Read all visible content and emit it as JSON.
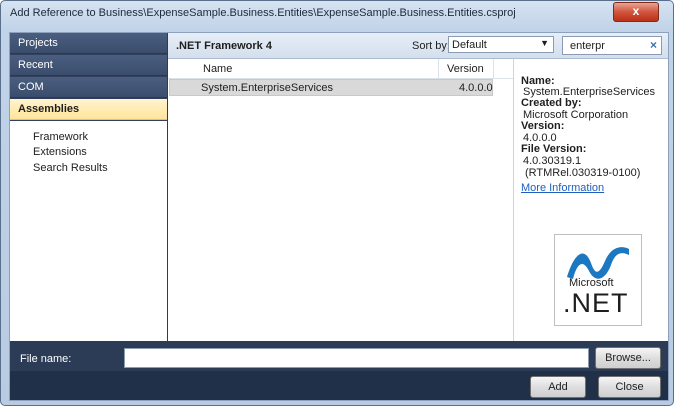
{
  "window": {
    "title": "Add Reference to Business\\ExpenseSample.Business.Entities\\ExpenseSample.Business.Entities.csproj",
    "close_label": "x"
  },
  "nav": {
    "tabs": [
      {
        "label": "Projects"
      },
      {
        "label": "Recent"
      },
      {
        "label": "COM"
      },
      {
        "label": "Assemblies"
      }
    ],
    "sub_items": [
      {
        "label": "Framework"
      },
      {
        "label": "Extensions"
      },
      {
        "label": "Search Results"
      }
    ]
  },
  "header": {
    "framework": ".NET Framework 4",
    "sort_label": "Sort by:",
    "sort_value": "Default",
    "search_value": "enterpr",
    "clear_icon": "×"
  },
  "list": {
    "columns": {
      "name": "Name",
      "version": "Version"
    },
    "rows": [
      {
        "name": "System.EnterpriseServices",
        "version": "4.0.0.0"
      }
    ]
  },
  "details": {
    "name_label": "Name:",
    "name_value": "System.EnterpriseServices",
    "created_label": "Created by:",
    "created_value": "Microsoft Corporation",
    "version_label": "Version:",
    "version_value": "4.0.0.0",
    "file_version_label": "File Version:",
    "file_version_value1": "4.0.30319.1",
    "file_version_value2": "(RTMRel.030319-0100)",
    "more_link": "More Information",
    "logo_microsoft": "Microsoft",
    "logo_net": ".NET"
  },
  "footer": {
    "file_name_label": "File name:",
    "file_name_value": "",
    "browse_label": "Browse...",
    "add_label": "Add",
    "close_label": "Close"
  },
  "colors": {
    "nav_bg": "#33415c",
    "active_tab": "#ffe49a",
    "link": "#1f5fbf",
    "net_logo": "#1c78c1"
  },
  "icons": [
    "close-icon",
    "chevron-down-icon",
    "clear-search-icon",
    "dotnet-logo"
  ]
}
